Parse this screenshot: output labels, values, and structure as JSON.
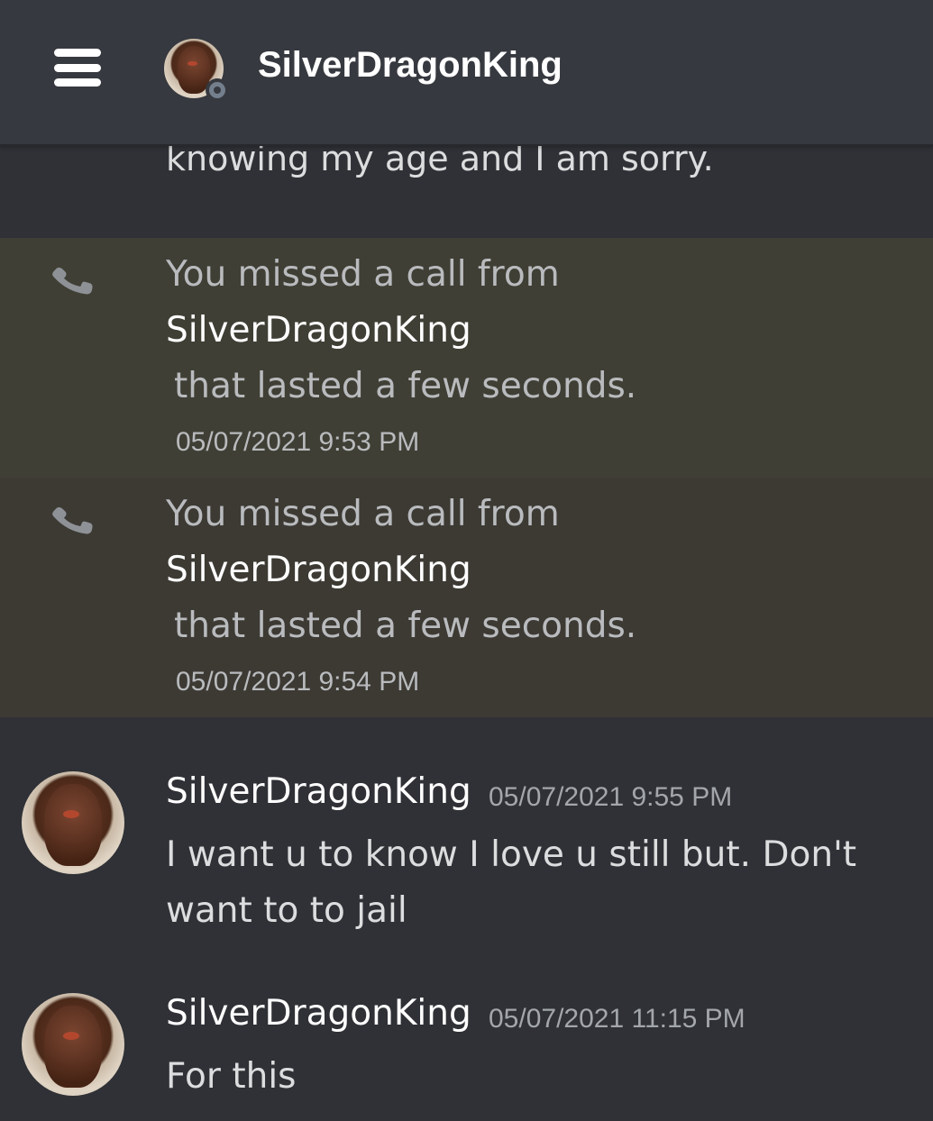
{
  "header": {
    "title": "SilverDragonKing",
    "menu_icon": "hamburger-menu-icon",
    "status": "offline"
  },
  "partial_message": {
    "text": "knowing my age and I am sorry."
  },
  "calls": [
    {
      "line1": "You missed a call from",
      "caller": "SilverDragonKing",
      "line3": "that lasted a few seconds.",
      "timestamp": "05/07/2021 9:53 PM",
      "icon": "missed-call-phone-icon"
    },
    {
      "line1": "You missed a call from",
      "caller": "SilverDragonKing",
      "line3": "that lasted a few seconds.",
      "timestamp": "05/07/2021 9:54 PM",
      "icon": "missed-call-phone-icon"
    }
  ],
  "messages": [
    {
      "author": "SilverDragonKing",
      "timestamp": "05/07/2021 9:55 PM",
      "text": "I want u to know I love u still but. Don't want to to jail"
    },
    {
      "author": "SilverDragonKing",
      "timestamp": "05/07/2021 11:15 PM",
      "text": "For this"
    }
  ],
  "colors": {
    "background": "#2f3136",
    "header": "#36393f",
    "missed_call_highlight": "#403f35",
    "phone_icon": "#8e9297"
  }
}
